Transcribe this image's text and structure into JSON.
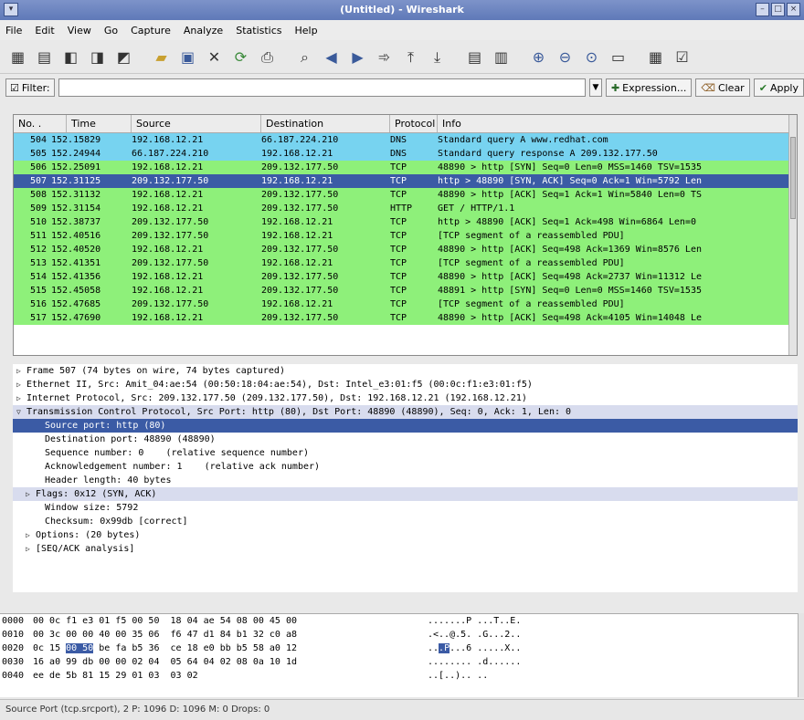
{
  "window": {
    "title": "(Untitled) - Wireshark"
  },
  "menu": [
    "File",
    "Edit",
    "View",
    "Go",
    "Capture",
    "Analyze",
    "Statistics",
    "Help"
  ],
  "toolbar_icons": [
    "interfaces-icon",
    "options-icon",
    "start-capture-icon",
    "stop-capture-icon",
    "restart-capture-icon",
    "open-icon",
    "save-icon",
    "close-icon",
    "reload-icon",
    "print-icon",
    "find-icon",
    "back-icon",
    "forward-icon",
    "goto-icon",
    "first-icon",
    "last-icon",
    "colorize-icon",
    "autoscroll-icon",
    "zoom-in-icon",
    "zoom-out-icon",
    "zoom-normal-icon",
    "resize-columns-icon",
    "capture-filters-icon",
    "display-filters-icon"
  ],
  "filter": {
    "label": "Filter:",
    "value": "",
    "expression_label": "Expression...",
    "clear_label": "Clear",
    "apply_label": "Apply"
  },
  "packet_list": {
    "headers": [
      "No. .",
      "Time",
      "Source",
      "Destination",
      "Protocol",
      "Info"
    ],
    "colors": {
      "dns": "#77d3f0",
      "tcp": "#8ef07a",
      "selected": "#3b5ba5"
    },
    "rows": [
      {
        "no": "504",
        "time": "152.15829",
        "src": "192.168.12.21",
        "dst": "66.187.224.210",
        "proto": "DNS",
        "info": "Standard query A www.redhat.com",
        "kind": "dns"
      },
      {
        "no": "505",
        "time": "152.24944",
        "src": "66.187.224.210",
        "dst": "192.168.12.21",
        "proto": "DNS",
        "info": "Standard query response A 209.132.177.50",
        "kind": "dns"
      },
      {
        "no": "506",
        "time": "152.25091",
        "src": "192.168.12.21",
        "dst": "209.132.177.50",
        "proto": "TCP",
        "info": "48890 > http [SYN] Seq=0 Len=0 MSS=1460 TSV=1535",
        "kind": "tcp"
      },
      {
        "no": "507",
        "time": "152.31125",
        "src": "209.132.177.50",
        "dst": "192.168.12.21",
        "proto": "TCP",
        "info": "http > 48890 [SYN, ACK] Seq=0 Ack=1 Win=5792 Len",
        "kind": "selected"
      },
      {
        "no": "508",
        "time": "152.31132",
        "src": "192.168.12.21",
        "dst": "209.132.177.50",
        "proto": "TCP",
        "info": "48890 > http [ACK] Seq=1 Ack=1 Win=5840 Len=0 TS",
        "kind": "tcp"
      },
      {
        "no": "509",
        "time": "152.31154",
        "src": "192.168.12.21",
        "dst": "209.132.177.50",
        "proto": "HTTP",
        "info": "GET / HTTP/1.1",
        "kind": "tcp"
      },
      {
        "no": "510",
        "time": "152.38737",
        "src": "209.132.177.50",
        "dst": "192.168.12.21",
        "proto": "TCP",
        "info": "http > 48890 [ACK] Seq=1 Ack=498 Win=6864 Len=0",
        "kind": "tcp"
      },
      {
        "no": "511",
        "time": "152.40516",
        "src": "209.132.177.50",
        "dst": "192.168.12.21",
        "proto": "TCP",
        "info": "[TCP segment of a reassembled PDU]",
        "kind": "tcp"
      },
      {
        "no": "512",
        "time": "152.40520",
        "src": "192.168.12.21",
        "dst": "209.132.177.50",
        "proto": "TCP",
        "info": "48890 > http [ACK] Seq=498 Ack=1369 Win=8576 Len",
        "kind": "tcp"
      },
      {
        "no": "513",
        "time": "152.41351",
        "src": "209.132.177.50",
        "dst": "192.168.12.21",
        "proto": "TCP",
        "info": "[TCP segment of a reassembled PDU]",
        "kind": "tcp"
      },
      {
        "no": "514",
        "time": "152.41356",
        "src": "192.168.12.21",
        "dst": "209.132.177.50",
        "proto": "TCP",
        "info": "48890 > http [ACK] Seq=498 Ack=2737 Win=11312 Le",
        "kind": "tcp"
      },
      {
        "no": "515",
        "time": "152.45058",
        "src": "192.168.12.21",
        "dst": "209.132.177.50",
        "proto": "TCP",
        "info": "48891 > http [SYN] Seq=0 Len=0 MSS=1460 TSV=1535",
        "kind": "tcp"
      },
      {
        "no": "516",
        "time": "152.47685",
        "src": "209.132.177.50",
        "dst": "192.168.12.21",
        "proto": "TCP",
        "info": "[TCP segment of a reassembled PDU]",
        "kind": "tcp"
      },
      {
        "no": "517",
        "time": "152.47690",
        "src": "192.168.12.21",
        "dst": "209.132.177.50",
        "proto": "TCP",
        "info": "48890 > http [ACK] Seq=498 Ack=4105 Win=14048 Le",
        "kind": "tcp"
      }
    ]
  },
  "detail_tree": [
    {
      "text": "Frame 507 (74 bytes on wire, 74 bytes captured)",
      "indent": 0,
      "twisty": "closed",
      "state": ""
    },
    {
      "text": "Ethernet II, Src: Amit_04:ae:54 (00:50:18:04:ae:54), Dst: Intel_e3:01:f5 (00:0c:f1:e3:01:f5)",
      "indent": 0,
      "twisty": "closed",
      "state": ""
    },
    {
      "text": "Internet Protocol, Src: 209.132.177.50 (209.132.177.50), Dst: 192.168.12.21 (192.168.12.21)",
      "indent": 0,
      "twisty": "closed",
      "state": ""
    },
    {
      "text": "Transmission Control Protocol, Src Port: http (80), Dst Port: 48890 (48890), Seq: 0, Ack: 1, Len: 0",
      "indent": 0,
      "twisty": "open",
      "state": "subsel"
    },
    {
      "text": "Source port: http (80)",
      "indent": 2,
      "twisty": "",
      "state": "selected"
    },
    {
      "text": "Destination port: 48890 (48890)",
      "indent": 2,
      "twisty": "",
      "state": ""
    },
    {
      "text": "Sequence number: 0    (relative sequence number)",
      "indent": 2,
      "twisty": "",
      "state": ""
    },
    {
      "text": "Acknowledgement number: 1    (relative ack number)",
      "indent": 2,
      "twisty": "",
      "state": ""
    },
    {
      "text": "Header length: 40 bytes",
      "indent": 2,
      "twisty": "",
      "state": ""
    },
    {
      "text": "Flags: 0x12 (SYN, ACK)",
      "indent": 1,
      "twisty": "closed",
      "state": "subsel"
    },
    {
      "text": "Window size: 5792",
      "indent": 2,
      "twisty": "",
      "state": ""
    },
    {
      "text": "Checksum: 0x99db [correct]",
      "indent": 2,
      "twisty": "",
      "state": ""
    },
    {
      "text": "Options: (20 bytes)",
      "indent": 1,
      "twisty": "closed",
      "state": ""
    },
    {
      "text": "[SEQ/ACK analysis]",
      "indent": 1,
      "twisty": "closed",
      "state": ""
    }
  ],
  "hex_dump": [
    {
      "offset": "0000",
      "bytes": "00 0c f1 e3 01 f5 00 50  18 04 ae 54 08 00 45 00",
      "ascii": ".......P ...T..E."
    },
    {
      "offset": "0010",
      "bytes": "00 3c 00 00 40 00 35 06  f6 47 d1 84 b1 32 c0 a8",
      "ascii": ".<..@.5. .G...2.."
    },
    {
      "offset": "0020",
      "bytes_pre": "0c 15 ",
      "bytes_hl": "00 50",
      "bytes_post": " be fa b5 36  ce 18 e0 bb b5 58 a0 12",
      "ascii_pre": "..",
      "ascii_hl": ".P",
      "ascii_post": "...6 .....X.."
    },
    {
      "offset": "0030",
      "bytes": "16 a0 99 db 00 00 02 04  05 64 04 02 08 0a 10 1d",
      "ascii": "........ .d......"
    },
    {
      "offset": "0040",
      "bytes": "ee de 5b 81 15 29 01 03  03 02",
      "ascii": "..[..).. .."
    }
  ],
  "status_bar": "Source Port (tcp.srcport), 2   P: 1096 D: 1096 M: 0 Drops: 0"
}
